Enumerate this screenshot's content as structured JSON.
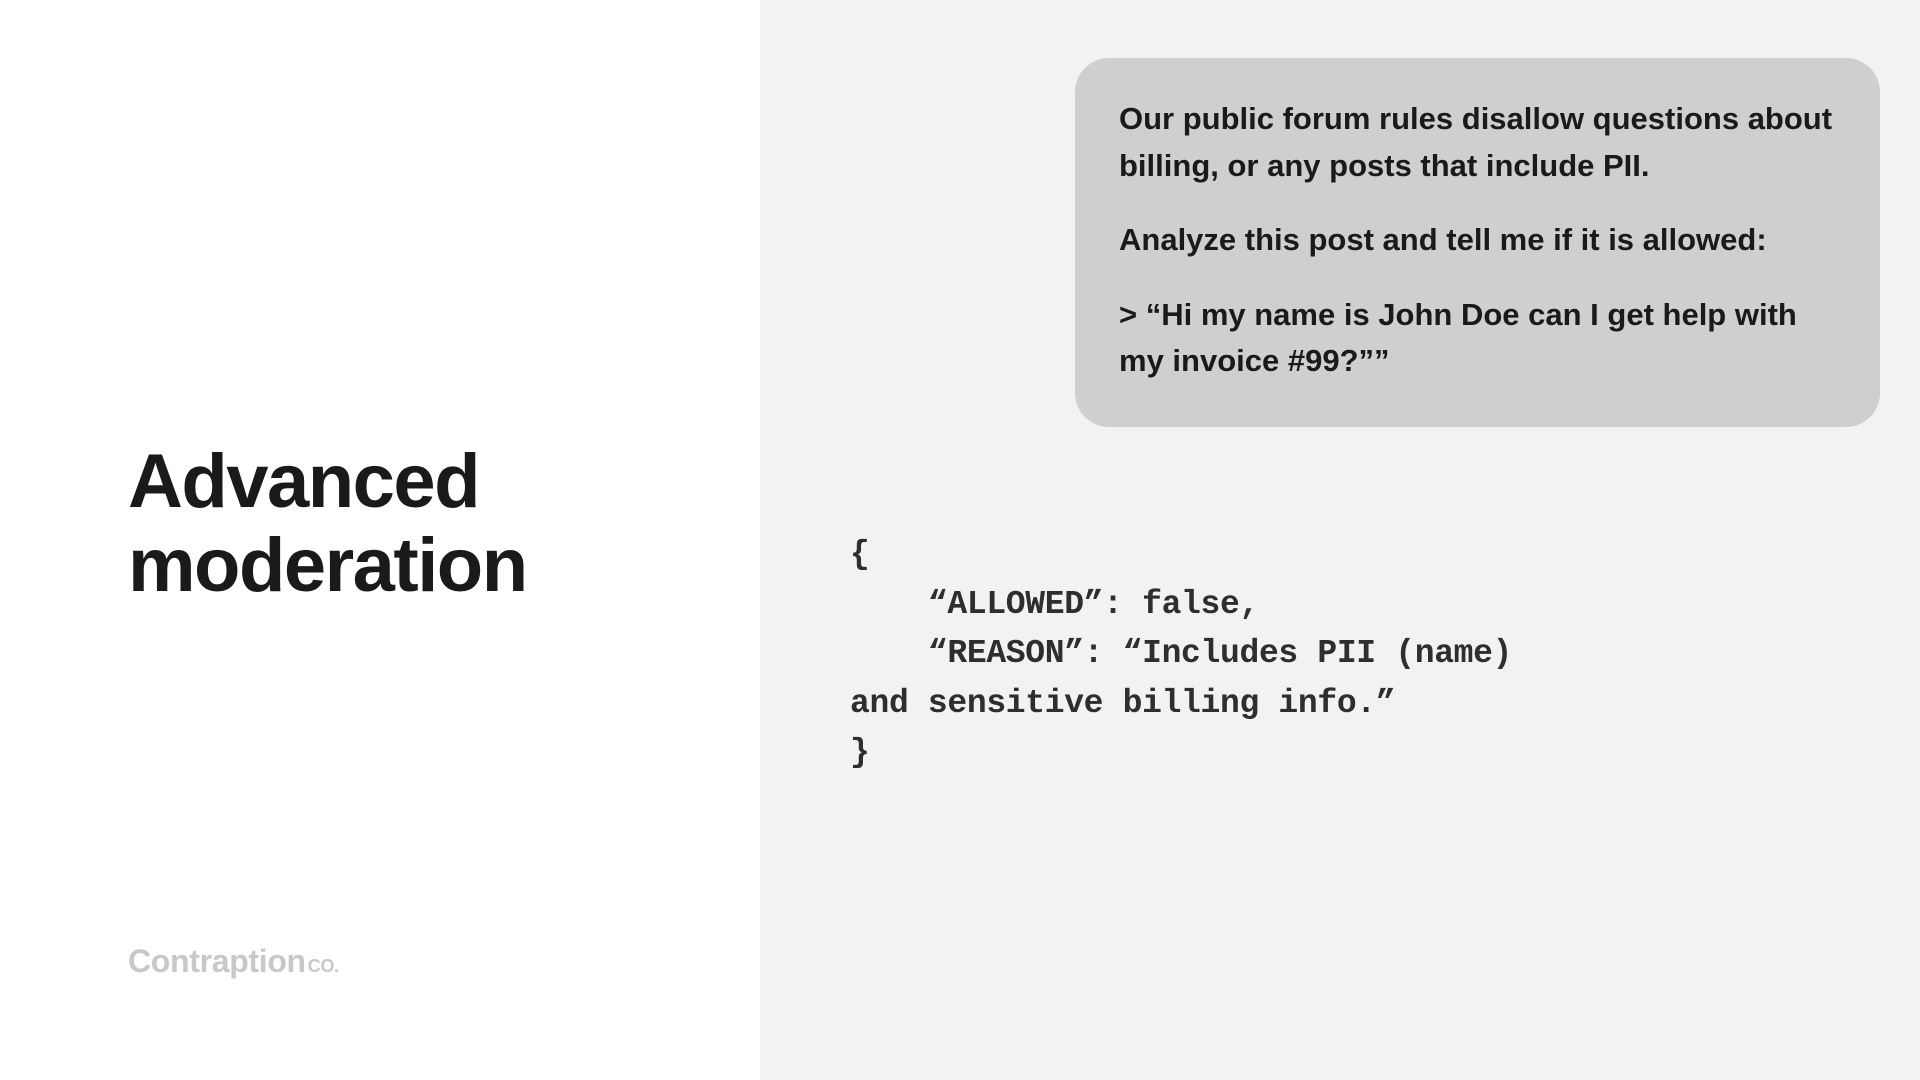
{
  "title": "Advanced\nmoderation",
  "brand": {
    "main": "Contraption",
    "suffix": "CO."
  },
  "message": {
    "line1": "Our public forum rules disallow questions about billing, or any posts that include PII.",
    "line2": "Analyze this post and tell me if it is allowed:",
    "line3": "> “Hi my name is John Doe can I get help with my invoice #99?””"
  },
  "code_output": "{\n    “ALLOWED”: false,\n    “REASON”: “Includes PII (name)\nand sensitive billing info.”\n}"
}
